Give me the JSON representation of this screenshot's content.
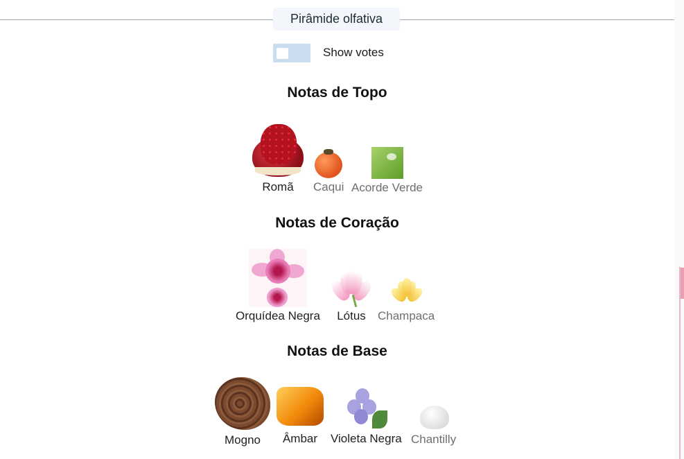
{
  "section": {
    "title": "Pirâmide olfativa"
  },
  "toggle": {
    "label": "Show votes",
    "checked": false
  },
  "tiers": {
    "top": {
      "title": "Notas de Topo",
      "notes": [
        {
          "name": "Romã",
          "icon": "pomegranate-image"
        },
        {
          "name": "Caqui",
          "icon": "persimmon-image"
        },
        {
          "name": "Acorde Verde",
          "icon": "green-accord-image"
        }
      ]
    },
    "heart": {
      "title": "Notas de Coração",
      "notes": [
        {
          "name": "Orquídea Negra",
          "icon": "orchid-image"
        },
        {
          "name": "Lótus",
          "icon": "lotus-image"
        },
        {
          "name": "Champaca",
          "icon": "champaca-image"
        }
      ]
    },
    "base": {
      "title": "Notas de Base",
      "notes": [
        {
          "name": "Mogno",
          "icon": "mahogany-image"
        },
        {
          "name": "Âmbar",
          "icon": "amber-image"
        },
        {
          "name": "Violeta Negra",
          "icon": "violet-image"
        },
        {
          "name": "Chantilly",
          "icon": "chantilly-image"
        }
      ]
    }
  },
  "colors": {
    "divider": "#9aa7b3",
    "title_bg": "#f3f7fb",
    "toggle_bg": "#c9ddee",
    "scroll_accent": "#e8a0b0"
  }
}
